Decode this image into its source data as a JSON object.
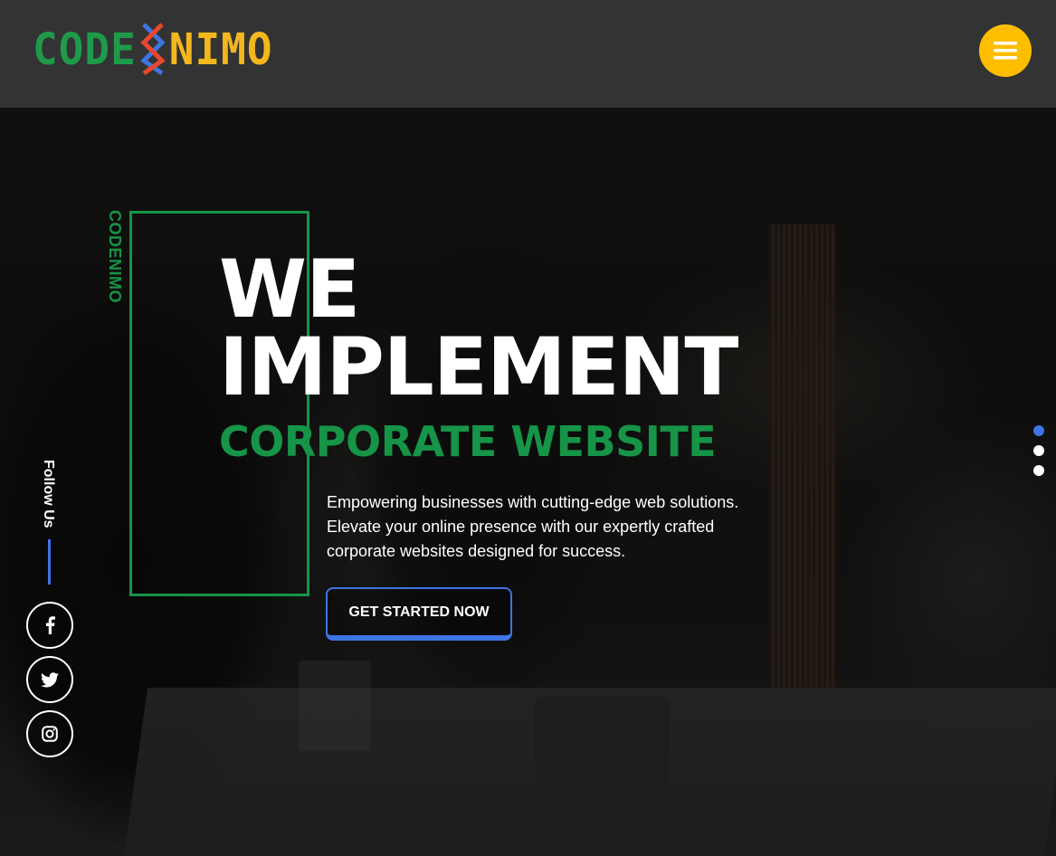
{
  "header": {
    "logo": {
      "part1": "CODE",
      "part2": "NIMO"
    },
    "menu_icon": "hamburger-icon"
  },
  "hero": {
    "vertical_brand": "CODENIMO",
    "headline_line1": "WE",
    "headline_line2": "IMPLEMENT",
    "subheadline": "CORPORATE WEBSITE",
    "description": "Empowering businesses with cutting-edge web solutions. Elevate your online presence with our expertly crafted corporate websites designed for success.",
    "cta_label": "GET STARTED NOW"
  },
  "social": {
    "follow_label": "Follow Us",
    "links": [
      {
        "icon": "facebook-icon"
      },
      {
        "icon": "twitter-icon"
      },
      {
        "icon": "instagram-icon"
      }
    ]
  },
  "slider": {
    "dots": 3,
    "active_index": 0
  },
  "colors": {
    "header_bg": "#333333",
    "brand_green": "#169447",
    "brand_yellow": "#ffbd00",
    "accent_blue": "#3f74e4"
  }
}
